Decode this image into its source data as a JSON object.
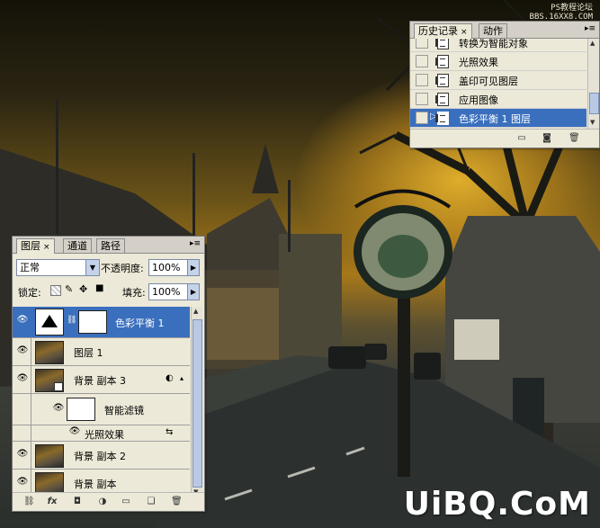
{
  "watermark": {
    "line1": "PS教程论坛",
    "line2": "BBS.16XX8.COM",
    "brand": "UiBQ.CoM"
  },
  "history_panel": {
    "tabs": [
      {
        "label": "历史记录",
        "active": true
      },
      {
        "label": "动作",
        "active": false
      }
    ],
    "close_glyph": "×",
    "items": [
      {
        "label": "转换为智能对象",
        "selected": false
      },
      {
        "label": "光照效果",
        "selected": false
      },
      {
        "label": "盖印可见图层",
        "selected": false
      },
      {
        "label": "应用图像",
        "selected": false
      },
      {
        "label": "色彩平衡 1 图层",
        "selected": true
      }
    ]
  },
  "layers_panel": {
    "tabs": [
      {
        "label": "图层",
        "active": true
      },
      {
        "label": "通道",
        "active": false
      },
      {
        "label": "路径",
        "active": false
      }
    ],
    "close_glyph": "×",
    "blend_mode": "正常",
    "opacity_label": "不透明度:",
    "opacity_value": "100%",
    "lock_label": "锁定:",
    "fill_label": "填充:",
    "fill_value": "100%",
    "layers": [
      {
        "name": "色彩平衡 1",
        "type": "adjustment",
        "selected": true
      },
      {
        "name": "图层 1",
        "type": "pixel",
        "selected": false
      },
      {
        "name": "背景 副本 3",
        "type": "smart",
        "selected": false
      },
      {
        "name": "智能滤镜",
        "type": "smart-filter-mask",
        "selected": false
      },
      {
        "name": "光照效果",
        "type": "filter",
        "selected": false
      },
      {
        "name": "背景 副本 2",
        "type": "pixel",
        "selected": false
      },
      {
        "name": "背景 副本",
        "type": "pixel",
        "selected": false
      }
    ]
  }
}
